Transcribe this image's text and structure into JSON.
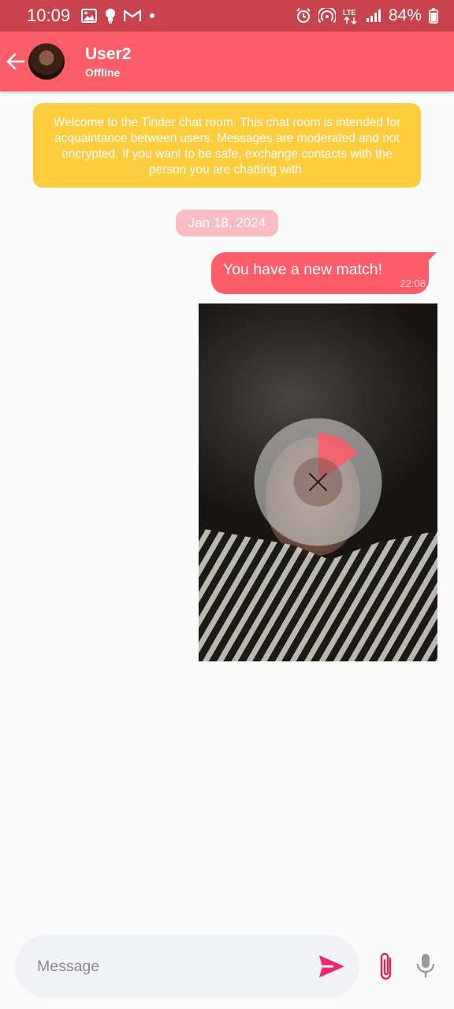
{
  "status_bar": {
    "time": "10:09",
    "battery": "84%",
    "network": "LTE"
  },
  "header": {
    "user_name": "User2",
    "user_status": "Offline"
  },
  "welcome_notice": "Welcome to the Tinder chat room. This chat room is intended for acquaintance between users. Messages are moderated and not encrypted. If you want to be safe, exchange contacts with the person you are chatting with.",
  "date_separator": "Jan 18, 2024",
  "messages": [
    {
      "text": "You have a new match!",
      "time": "22:08"
    }
  ],
  "photo_message": {
    "upload_progress": 0.15,
    "cancel_icon": "close-icon"
  },
  "composer": {
    "placeholder": "Message"
  },
  "colors": {
    "brand": "#fd5c69",
    "status_bar": "#c9434f",
    "notice": "#fdcd3e",
    "date_pill": "#f9bcc3",
    "send": "#f0266e"
  }
}
